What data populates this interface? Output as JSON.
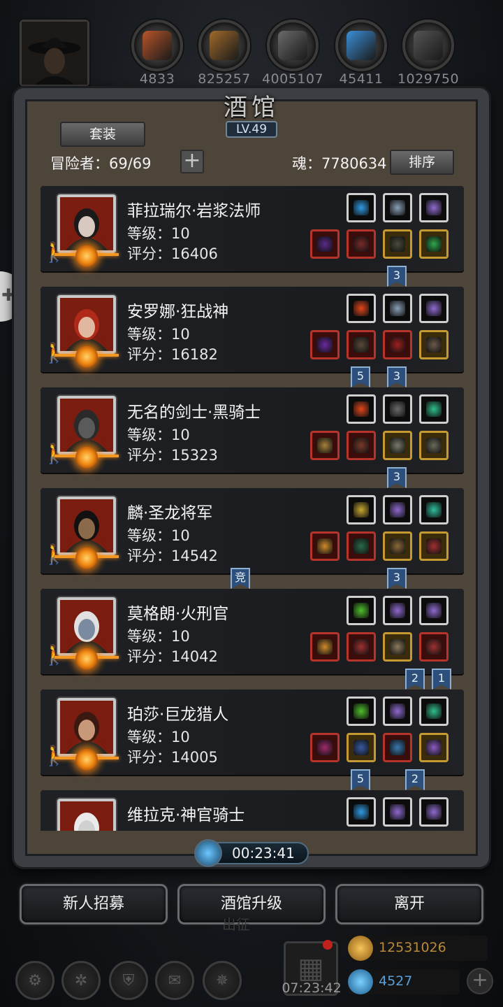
{
  "resources": [
    {
      "id": "meat",
      "value": "4833",
      "color": "#b8552a"
    },
    {
      "id": "wood",
      "value": "825257",
      "color": "#a06a2a"
    },
    {
      "id": "iron",
      "value": "4005107",
      "color": "#6a6a6a"
    },
    {
      "id": "crystal",
      "value": "45411",
      "color": "#3b8fd8"
    },
    {
      "id": "stone",
      "value": "1029750",
      "color": "#555555"
    }
  ],
  "panel": {
    "title": "酒馆",
    "level": "LV.49",
    "set_button": "套装",
    "adventurers": "冒险者：69/69",
    "add_icon": "+",
    "soul": "魂：7780634",
    "sort_button": "排序"
  },
  "heroes": [
    {
      "name": "菲拉瑞尔·岩浆法师",
      "level": "等级：10",
      "score": "评分：16406",
      "top_slots": [
        {
          "color": "#2e9be6",
          "icon": "orb-icon"
        },
        {
          "color": "#8aa0b6",
          "icon": "book-icon"
        },
        {
          "color": "#8f6ad0",
          "icon": "crystal-icon"
        }
      ],
      "bottom_slots": [
        {
          "tier": "red",
          "color": "#5a2a8a",
          "icon": "staff-icon"
        },
        {
          "tier": "red",
          "color": "#7a2a2a",
          "icon": "robe-icon"
        },
        {
          "tier": "gold",
          "color": "#4a4a3a",
          "icon": "helmet-icon"
        },
        {
          "tier": "gold",
          "color": "#2ea84a",
          "icon": "gem-icon"
        }
      ],
      "ribbons": [
        {
          "label": "3",
          "slot": 2
        }
      ]
    },
    {
      "name": "安罗娜·狂战神",
      "level": "等级：10",
      "score": "评分：16182",
      "top_slots": [
        {
          "color": "#e4461a",
          "icon": "flame-icon"
        },
        {
          "color": "#8aa0b6",
          "icon": "book-icon"
        },
        {
          "color": "#8f6ad0",
          "icon": "crystal-icon"
        }
      ],
      "bottom_slots": [
        {
          "tier": "red",
          "color": "#6a2aa0",
          "icon": "axe-icon"
        },
        {
          "tier": "red",
          "color": "#5a4a3a",
          "icon": "armor-icon"
        },
        {
          "tier": "red",
          "color": "#a02020",
          "icon": "ring-icon"
        },
        {
          "tier": "gold",
          "color": "#6a5a4a",
          "icon": "amulet-icon"
        }
      ],
      "ribbons": [
        {
          "label": "5",
          "slot": 1
        },
        {
          "label": "3",
          "slot": 2
        }
      ]
    },
    {
      "name": "无名的剑士·黑骑士",
      "level": "等级：10",
      "score": "评分：15323",
      "top_slots": [
        {
          "color": "#e4461a",
          "icon": "flame-icon"
        },
        {
          "color": "#6a6a6a",
          "icon": "emblem-icon"
        },
        {
          "color": "#2ec08a",
          "icon": "stone-icon"
        }
      ],
      "bottom_slots": [
        {
          "tier": "red",
          "color": "#a8803a",
          "icon": "sword-icon"
        },
        {
          "tier": "red",
          "color": "#7a3a2a",
          "icon": "plate-icon"
        },
        {
          "tier": "gold",
          "color": "#7a7a6a",
          "icon": "gauntlet-icon"
        },
        {
          "tier": "gold",
          "color": "#6a6a5a",
          "icon": "shield-icon"
        }
      ],
      "ribbons": [
        {
          "label": "3",
          "slot": 2
        }
      ]
    },
    {
      "name": "麟·圣龙将军",
      "level": "等级：10",
      "score": "评分：14542",
      "top_slots": [
        {
          "color": "#c8a830",
          "icon": "mask-icon"
        },
        {
          "color": "#8f6ad0",
          "icon": "crystal-icon"
        },
        {
          "color": "#2ec0a0",
          "icon": "stone-icon"
        }
      ],
      "bottom_slots": [
        {
          "tier": "red",
          "color": "#d08a2a",
          "icon": "sword-icon"
        },
        {
          "tier": "red",
          "color": "#2a6a4a",
          "icon": "armor-icon"
        },
        {
          "tier": "gold",
          "color": "#8a6a3a",
          "icon": "amulet-icon"
        },
        {
          "tier": "gold",
          "color": "#a03030",
          "icon": "necklace-icon"
        }
      ],
      "ribbons": [
        {
          "label": "竞",
          "slot": -1
        },
        {
          "label": "3",
          "slot": 2
        }
      ]
    },
    {
      "name": "莫格朗·火刑官",
      "level": "等级：10",
      "score": "评分：14042",
      "top_slots": [
        {
          "color": "#4ec02a",
          "icon": "potion-icon"
        },
        {
          "color": "#8f6ad0",
          "icon": "crystal-icon"
        },
        {
          "color": "#8f6ad0",
          "icon": "crystal-icon"
        }
      ],
      "bottom_slots": [
        {
          "tier": "red",
          "color": "#d08a2a",
          "icon": "hammer-icon"
        },
        {
          "tier": "red",
          "color": "#a03030",
          "icon": "armor-icon"
        },
        {
          "tier": "gold",
          "color": "#8a7a5a",
          "icon": "staff-icon"
        },
        {
          "tier": "red",
          "color": "#a03030",
          "icon": "ring-icon"
        }
      ],
      "ribbons": [
        {
          "label": "2",
          "slot": 3
        },
        {
          "label": "1",
          "slot": 4
        }
      ]
    },
    {
      "name": "珀莎·巨龙猎人",
      "level": "等级：10",
      "score": "评分：14005",
      "top_slots": [
        {
          "color": "#4ec02a",
          "icon": "potion-icon"
        },
        {
          "color": "#8f6ad0",
          "icon": "crystal-icon"
        },
        {
          "color": "#2ec08a",
          "icon": "stone-icon"
        }
      ],
      "bottom_slots": [
        {
          "tier": "red",
          "color": "#a02a6a",
          "icon": "bow-icon"
        },
        {
          "tier": "gold",
          "color": "#3a5aa0",
          "icon": "armor-icon"
        },
        {
          "tier": "red",
          "color": "#3a7ab0",
          "icon": "gauntlet-icon"
        },
        {
          "tier": "gold",
          "color": "#8a5ac0",
          "icon": "ring-icon"
        }
      ],
      "ribbons": [
        {
          "label": "5",
          "slot": 1
        },
        {
          "label": "2",
          "slot": 3
        }
      ]
    },
    {
      "name": "维拉克·神官骑士",
      "level": "",
      "score": "",
      "top_slots": [
        {
          "color": "#2e9be6",
          "icon": "orb-icon"
        },
        {
          "color": "#8f6ad0",
          "icon": "crystal-icon"
        },
        {
          "color": "#8f6ad0",
          "icon": "crystal-icon"
        }
      ],
      "bottom_slots": [],
      "ribbons": []
    }
  ],
  "timer": "00:23:41",
  "actions": {
    "recruit": "新人招募",
    "upgrade": "酒馆升级",
    "leave": "离开"
  },
  "bottom": {
    "expedition": "出征",
    "gift_timer": "07:23:42",
    "gold": "12531026",
    "gems": "4527"
  }
}
